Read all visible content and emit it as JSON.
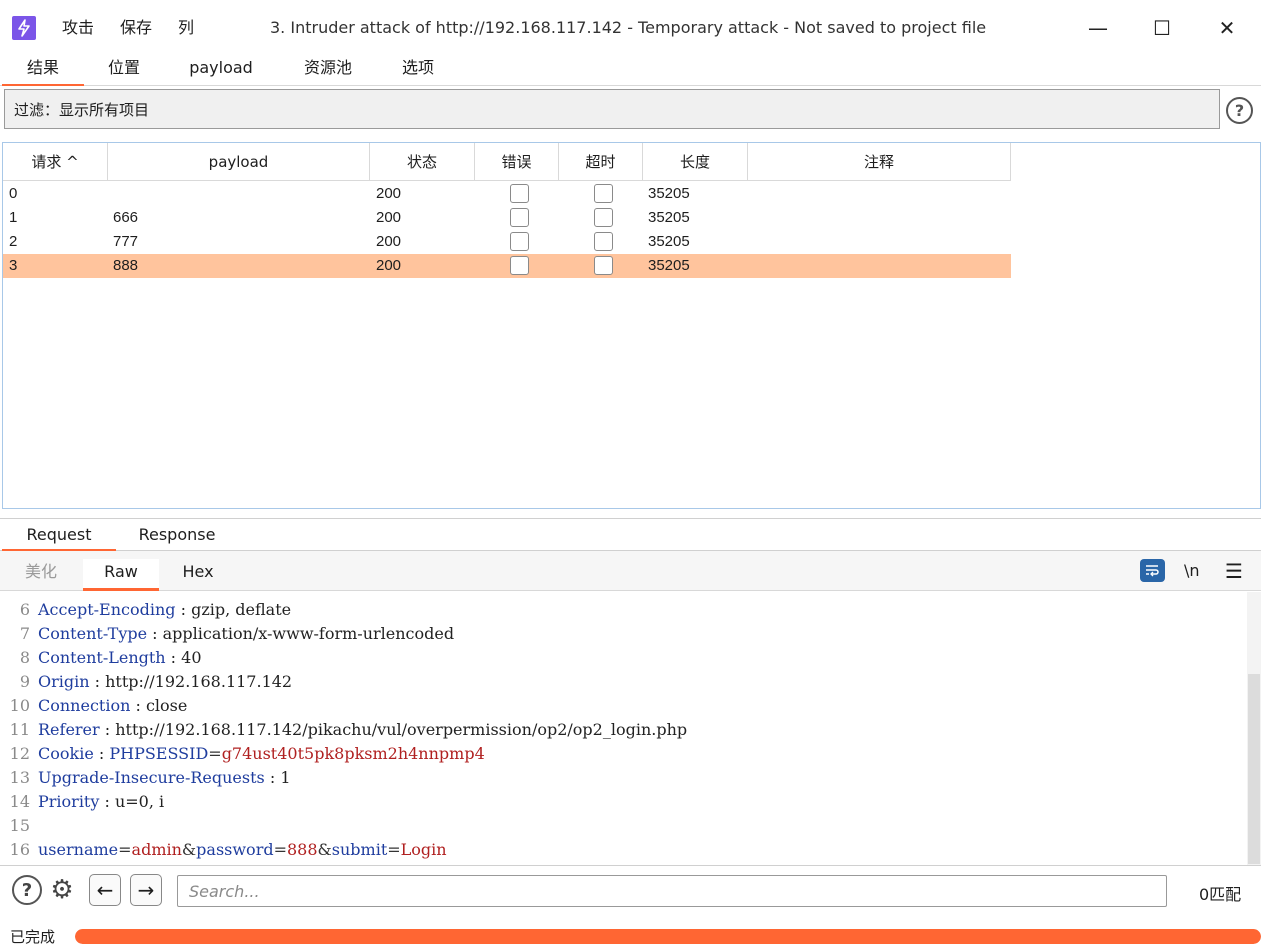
{
  "titlebar": {
    "menu": [
      "攻击",
      "保存",
      "列"
    ],
    "title": "3. Intruder attack of http://192.168.117.142 - Temporary attack - Not saved to project file",
    "minimize": "—",
    "maximize": "☐",
    "close": "✕"
  },
  "tabs": [
    "结果",
    "位置",
    "payload",
    "资源池",
    "选项"
  ],
  "filter": {
    "text": "过滤：显示所有项目",
    "help": "?"
  },
  "table": {
    "headers": [
      "请求 ^",
      "payload",
      "状态",
      "错误",
      "超时",
      "长度",
      "注释"
    ],
    "rows": [
      {
        "request": "0",
        "payload": "",
        "status": "200",
        "error": false,
        "timeout": false,
        "length": "35205",
        "comment": ""
      },
      {
        "request": "1",
        "payload": "666",
        "status": "200",
        "error": false,
        "timeout": false,
        "length": "35205",
        "comment": ""
      },
      {
        "request": "2",
        "payload": "777",
        "status": "200",
        "error": false,
        "timeout": false,
        "length": "35205",
        "comment": ""
      },
      {
        "request": "3",
        "payload": "888",
        "status": "200",
        "error": false,
        "timeout": false,
        "length": "35205",
        "comment": ""
      }
    ],
    "selected_row": 3,
    "selected_color": "#ffc49d"
  },
  "request_tabs": [
    "Request",
    "Response"
  ],
  "sub_tabs": [
    "美化",
    "Raw",
    "Hex"
  ],
  "editor_tools": {
    "wrap_icon": "wrap-lines-icon",
    "newline": "\\n",
    "menu": "☰"
  },
  "code_lines": [
    {
      "n": "6",
      "parts": [
        {
          "t": "Accept-Encoding",
          "c": "k"
        },
        {
          "t": " : gzip, deflate",
          "c": "v"
        }
      ]
    },
    {
      "n": "7",
      "parts": [
        {
          "t": "Content-Type",
          "c": "k"
        },
        {
          "t": " : application/x-www-form-urlencoded",
          "c": "v"
        }
      ]
    },
    {
      "n": "8",
      "parts": [
        {
          "t": "Content-Length",
          "c": "k"
        },
        {
          "t": " : 40",
          "c": "v"
        }
      ]
    },
    {
      "n": "9",
      "parts": [
        {
          "t": "Origin",
          "c": "k"
        },
        {
          "t": " : http://192.168.117.142",
          "c": "v"
        }
      ]
    },
    {
      "n": "10",
      "parts": [
        {
          "t": "Connection",
          "c": "k"
        },
        {
          "t": " : close",
          "c": "v"
        }
      ]
    },
    {
      "n": "11",
      "parts": [
        {
          "t": "Referer",
          "c": "k"
        },
        {
          "t": " : http://192.168.117.142/pikachu/vul/overpermission/op2/op2_login.php",
          "c": "v"
        }
      ]
    },
    {
      "n": "12",
      "parts": [
        {
          "t": "Cookie",
          "c": "k"
        },
        {
          "t": " : ",
          "c": "v"
        },
        {
          "t": "PHPSESSID",
          "c": "k"
        },
        {
          "t": "=",
          "c": "p"
        },
        {
          "t": "g74ust40t5pk8pksm2h4nnpmp4",
          "c": "r"
        }
      ]
    },
    {
      "n": "13",
      "parts": [
        {
          "t": "Upgrade-Insecure-Requests",
          "c": "k"
        },
        {
          "t": " : 1",
          "c": "v"
        }
      ]
    },
    {
      "n": "14",
      "parts": [
        {
          "t": "Priority",
          "c": "k"
        },
        {
          "t": " : u=0, i",
          "c": "v"
        }
      ]
    },
    {
      "n": "15",
      "parts": []
    },
    {
      "n": "16",
      "parts": [
        {
          "t": "username",
          "c": "k"
        },
        {
          "t": "=",
          "c": "p"
        },
        {
          "t": "admin",
          "c": "r"
        },
        {
          "t": "&",
          "c": "p"
        },
        {
          "t": "password",
          "c": "k"
        },
        {
          "t": "=",
          "c": "p"
        },
        {
          "t": "888",
          "c": "r"
        },
        {
          "t": "&",
          "c": "p"
        },
        {
          "t": "submit",
          "c": "k"
        },
        {
          "t": "=",
          "c": "p"
        },
        {
          "t": "Login",
          "c": "r"
        }
      ]
    }
  ],
  "bottom": {
    "help": "?",
    "gear": "⚙",
    "back": "←",
    "forward": "→",
    "search_placeholder": "Search...",
    "match_count": "0匹配"
  },
  "status": {
    "text": "已完成",
    "progress": 1.0,
    "accent": "#ff6633"
  }
}
